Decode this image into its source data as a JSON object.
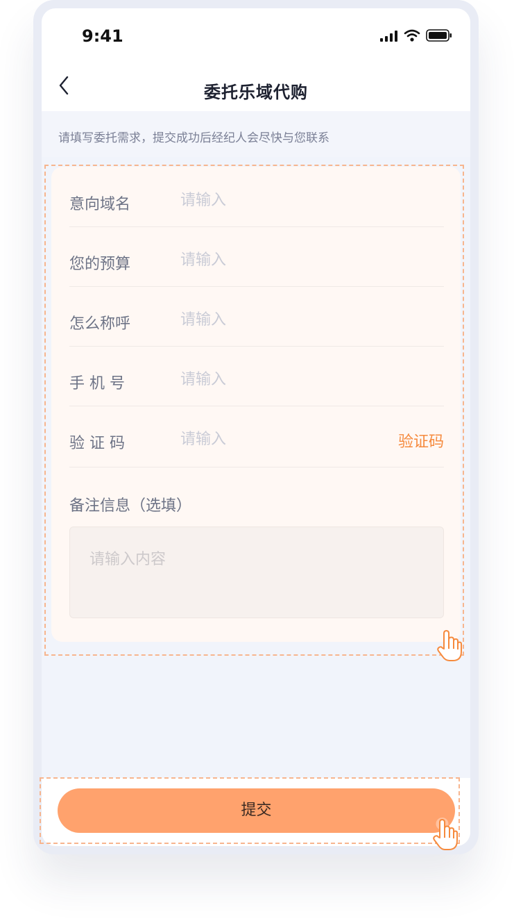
{
  "status_bar": {
    "time": "9:41"
  },
  "nav": {
    "title": "委托乐域代购"
  },
  "notice": {
    "text": "请填写委托需求，提交成功后经纪人会尽快与您联系"
  },
  "form": {
    "fields": [
      {
        "label": "意向域名",
        "placeholder": "请输入",
        "value": ""
      },
      {
        "label": "您的预算",
        "placeholder": "请输入",
        "value": ""
      },
      {
        "label": "怎么称呼",
        "placeholder": "请输入",
        "value": ""
      },
      {
        "label": "手 机 号",
        "placeholder": "请输入",
        "value": ""
      },
      {
        "label": "验 证 码",
        "placeholder": "请输入",
        "value": ""
      }
    ],
    "code_button": "验证码",
    "remark_label": "备注信息（选填）",
    "remark_placeholder": "请输入内容"
  },
  "submit": {
    "label": "提交"
  },
  "colors": {
    "accent": "#f68a3d",
    "submit_bg": "#ffa26d",
    "page_bg": "#f1f4fb",
    "card_bg": "#fff8f4",
    "dash_outline": "#f7b58e"
  },
  "icons": [
    "back-chevron-icon",
    "signal-icon",
    "wifi-icon",
    "battery-icon",
    "pointer-hand-icon"
  ]
}
